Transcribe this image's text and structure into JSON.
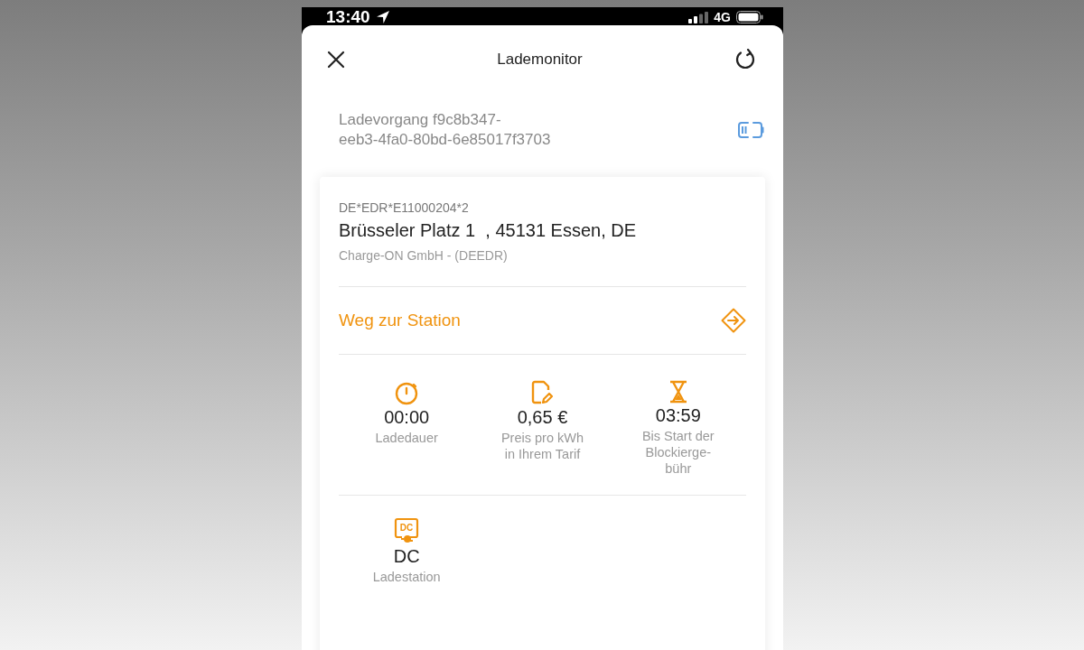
{
  "status_bar": {
    "time": "13:40",
    "network": "4G"
  },
  "header": {
    "title": "Lademonitor"
  },
  "session": {
    "label": "Ladevorgang f9c8b347-\neeb3-4fa0-80bd-6e85017f3703"
  },
  "station": {
    "evse_id": "DE*EDR*E11000204*2",
    "address": "Brüsseler Platz 1  , 45131 Essen, DE",
    "operator": "Charge-ON GmbH - (DEEDR)"
  },
  "route_link": {
    "label": "Weg zur Station"
  },
  "stats": [
    {
      "kind": "stopwatch",
      "value": "00:00",
      "label": "Ladedauer"
    },
    {
      "kind": "tariff",
      "value": "0,65 €",
      "label": "Preis pro kWh\nin Ihrem Tarif"
    },
    {
      "kind": "hourglass",
      "value": "03:59",
      "label": "Bis Start der\nBlockierge-\nbühr"
    }
  ],
  "station_stats": [
    {
      "kind": "plug",
      "icon_text": "DC",
      "value": "DC",
      "label": "Ladestation"
    }
  ]
}
